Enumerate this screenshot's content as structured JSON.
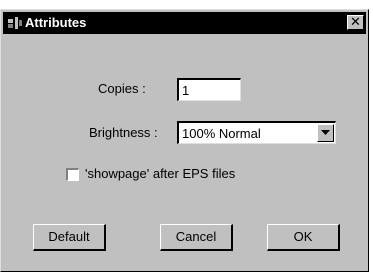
{
  "window": {
    "title": "Attributes",
    "close_glyph": "✕"
  },
  "copies": {
    "label": "Copies :",
    "value": "1"
  },
  "brightness": {
    "label": "Brightness :",
    "selected": "100% Normal"
  },
  "showpage": {
    "label": "'showpage' after EPS files",
    "checked": false
  },
  "buttons": {
    "default": "Default",
    "cancel": "Cancel",
    "ok": "OK"
  },
  "icons": {
    "title": "app-icon",
    "close": "close-icon",
    "dropdown": "chevron-down-icon"
  }
}
